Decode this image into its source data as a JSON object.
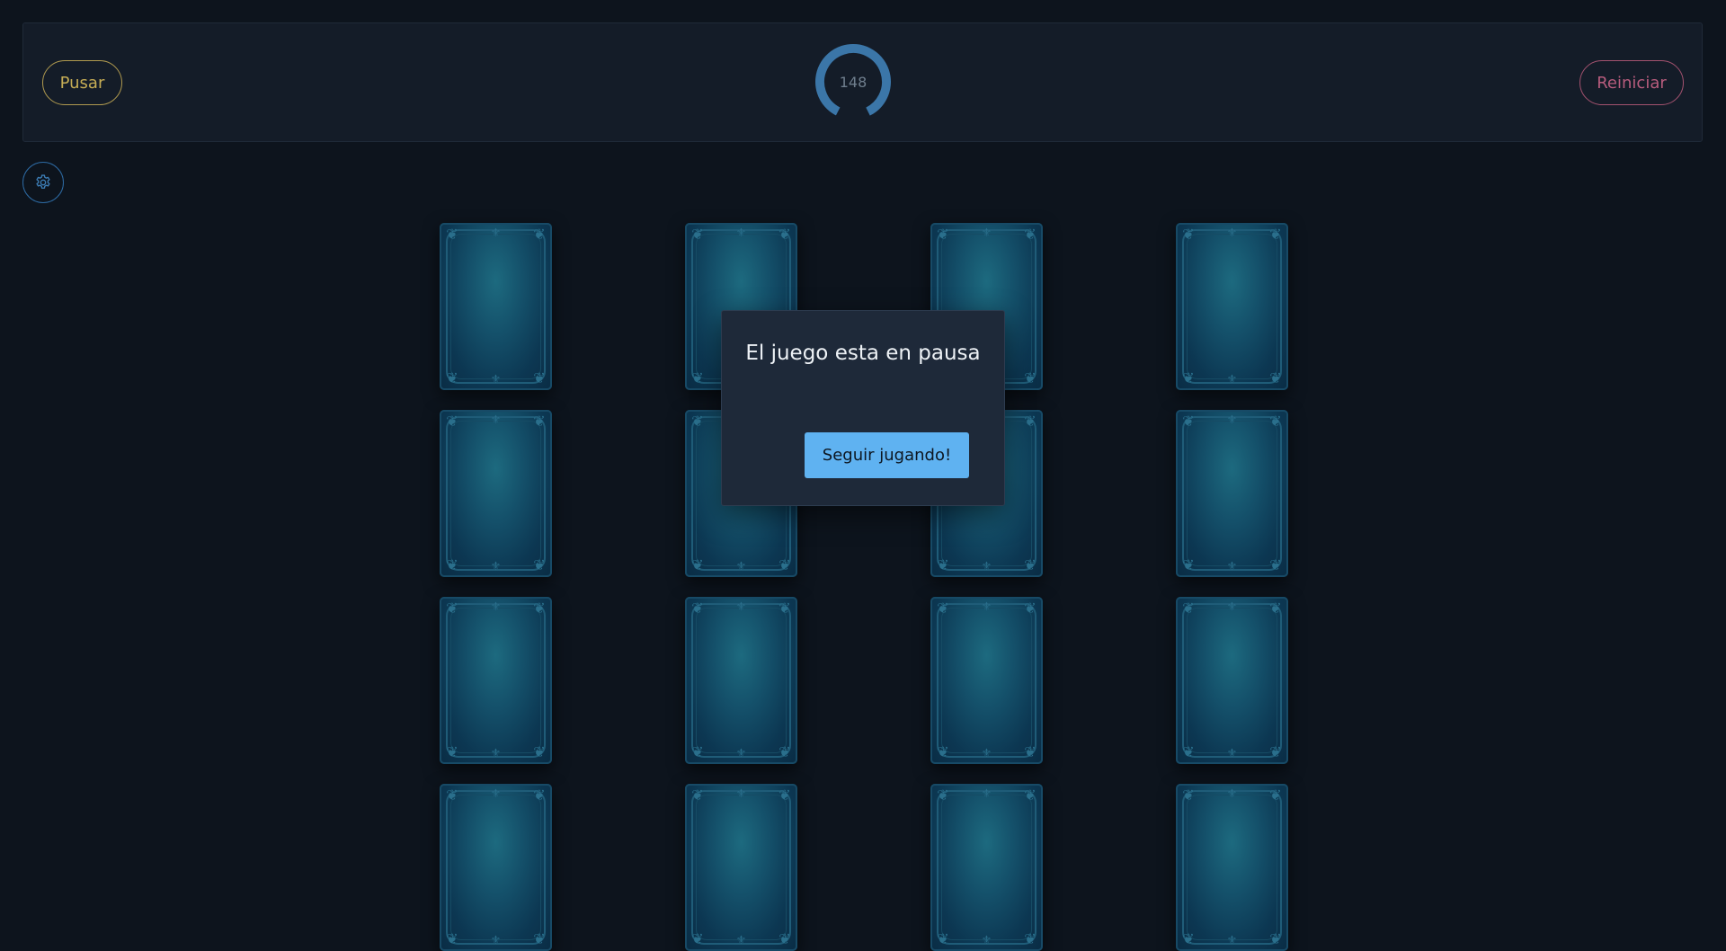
{
  "header": {
    "pause_label": "Pusar",
    "restart_label": "Reiniciar",
    "timer_value": "148",
    "timer_fraction_remaining": 0.85
  },
  "settings": {
    "icon": "gear-icon"
  },
  "board": {
    "rows_visible": 4,
    "columns": 4,
    "card_state": "face-down"
  },
  "modal": {
    "title": "El juego esta en pausa",
    "continue_label": "Seguir jugando!"
  },
  "colors": {
    "background": "#0d141d",
    "panel": "#141c28",
    "pause_accent": "#c6ad55",
    "restart_accent": "#b75c7d",
    "timer_ring": "#3b76a8",
    "settings_accent": "#2d6aa3",
    "modal_bg": "#1e2939",
    "modal_button": "#5fb2f1",
    "card_back": "#14506a"
  }
}
